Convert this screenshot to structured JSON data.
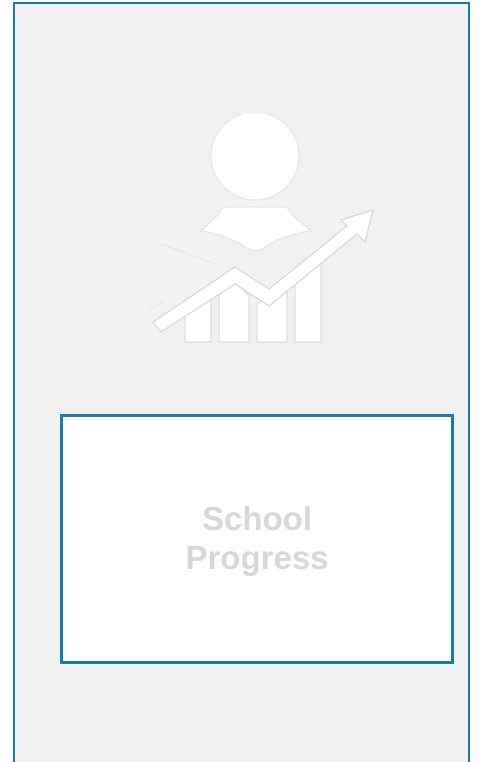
{
  "tile": {
    "icon": "student-progress-icon",
    "label": "School Progress"
  },
  "colors": {
    "border": "#1c7aa6",
    "card_background": "#f1f1f1",
    "label_text": "#d8d8d8",
    "icon_fill": "#ffffff"
  }
}
